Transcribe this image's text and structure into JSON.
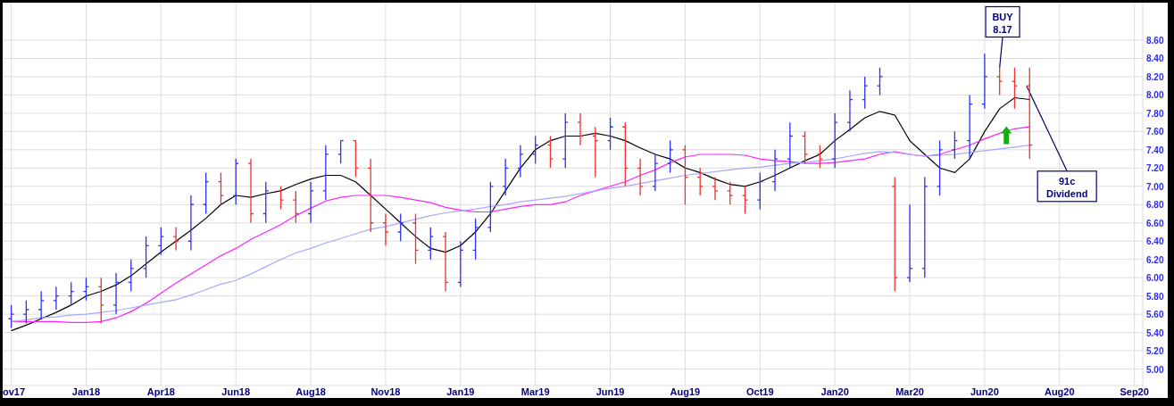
{
  "chart": {
    "chart_data": {
      "type": "line",
      "ylim": [
        4.82,
        9.01
      ],
      "grid": true,
      "categories": [
        "ov17",
        null,
        null,
        null,
        null,
        "Jan18",
        null,
        null,
        null,
        null,
        "Apr18",
        null,
        null,
        null,
        null,
        "Jun18",
        null,
        null,
        null,
        null,
        "Aug18",
        null,
        null,
        null,
        null,
        "Nov18",
        null,
        null,
        null,
        null,
        "Jan19",
        null,
        null,
        null,
        null,
        "Mar19",
        null,
        null,
        null,
        null,
        "Jun19",
        null,
        null,
        null,
        null,
        "Aug19",
        null,
        null,
        null,
        null,
        "Oct19",
        null,
        null,
        null,
        null,
        "Jan20",
        null,
        null,
        null,
        null,
        "Mar20",
        null,
        null,
        null,
        null,
        "Jun20",
        null,
        null,
        null,
        null,
        "Aug20",
        null,
        null,
        null,
        null,
        "Sep20"
      ],
      "yticks": [
        {
          "value": 5.0,
          "label": "5.00"
        },
        {
          "value": 5.2,
          "label": "5.20"
        },
        {
          "value": 5.4,
          "label": "5.40"
        },
        {
          "value": 5.6,
          "label": "5.60"
        },
        {
          "value": 5.8,
          "label": "5.80"
        },
        {
          "value": 6.0,
          "label": "6.00"
        },
        {
          "value": 6.2,
          "label": "6.20"
        },
        {
          "value": 6.4,
          "label": "6.40"
        },
        {
          "value": 6.6,
          "label": "6.60"
        },
        {
          "value": 6.8,
          "label": "6.80"
        },
        {
          "value": 7.0,
          "label": "7.00"
        },
        {
          "value": 7.2,
          "label": "7.20"
        },
        {
          "value": 7.4,
          "label": "7.40"
        },
        {
          "value": 7.6,
          "label": "7.60"
        },
        {
          "value": 7.8,
          "label": "7.80"
        },
        {
          "value": 8.0,
          "label": "8.00"
        },
        {
          "value": 8.2,
          "label": "8.20"
        },
        {
          "value": 8.4,
          "label": "8.40"
        },
        {
          "value": 8.6,
          "label": "8.60"
        }
      ],
      "series": [
        {
          "color": "#000000",
          "values": [
            5.42,
            5.48,
            5.55,
            5.62,
            5.7,
            5.8,
            5.85,
            5.92,
            6.02,
            6.15,
            6.28,
            6.4,
            6.52,
            6.65,
            6.8,
            6.9,
            6.88,
            6.92,
            6.95,
            7.02,
            7.08,
            7.12,
            7.12,
            7.05,
            6.9,
            6.75,
            6.6,
            6.45,
            6.32,
            6.28,
            6.35,
            6.5,
            6.7,
            6.95,
            7.2,
            7.4,
            7.5,
            7.55,
            7.55,
            7.58,
            7.55,
            7.5,
            7.42,
            7.35,
            7.3,
            7.2,
            7.15,
            7.08,
            7.02,
            7.0,
            7.05,
            7.12,
            7.2,
            7.28,
            7.35,
            7.5,
            7.62,
            7.75,
            7.82,
            7.78,
            7.5,
            7.35,
            7.2,
            7.15,
            7.3,
            7.6,
            7.85,
            7.97,
            7.95,
            null,
            null,
            null,
            null,
            null,
            null,
            null
          ]
        },
        {
          "color": "#ff22ff",
          "values": [
            5.52,
            5.52,
            5.52,
            5.52,
            5.51,
            5.51,
            5.52,
            5.56,
            5.63,
            5.72,
            5.83,
            5.94,
            6.04,
            6.14,
            6.24,
            6.32,
            6.42,
            6.5,
            6.58,
            6.68,
            6.76,
            6.84,
            6.88,
            6.9,
            6.9,
            6.9,
            6.88,
            6.85,
            6.82,
            6.77,
            6.74,
            6.72,
            6.72,
            6.75,
            6.78,
            6.8,
            6.8,
            6.83,
            6.9,
            6.95,
            7.0,
            7.05,
            7.12,
            7.18,
            7.26,
            7.32,
            7.35,
            7.35,
            7.35,
            7.34,
            7.3,
            7.28,
            7.27,
            7.25,
            7.25,
            7.26,
            7.28,
            7.3,
            7.35,
            7.38,
            7.35,
            7.33,
            7.35,
            7.4,
            7.45,
            7.52,
            7.58,
            7.63,
            7.65,
            null,
            null,
            null,
            null,
            null,
            null,
            null
          ]
        },
        {
          "color": "#a8a8ff",
          "values": [
            5.52,
            5.54,
            5.56,
            5.57,
            5.59,
            5.6,
            5.62,
            5.64,
            5.67,
            5.7,
            5.73,
            5.76,
            5.81,
            5.87,
            5.93,
            5.97,
            6.04,
            6.12,
            6.2,
            6.27,
            6.32,
            6.38,
            6.43,
            6.48,
            6.53,
            6.56,
            6.6,
            6.64,
            6.68,
            6.71,
            6.73,
            6.75,
            6.78,
            6.8,
            6.83,
            6.85,
            6.87,
            6.89,
            6.92,
            6.95,
            6.98,
            7.0,
            7.03,
            7.06,
            7.09,
            7.12,
            7.14,
            7.16,
            7.18,
            7.2,
            7.21,
            7.23,
            7.25,
            7.26,
            7.28,
            7.3,
            7.33,
            7.36,
            7.38,
            7.37,
            7.35,
            7.33,
            7.34,
            7.35,
            7.37,
            7.39,
            7.41,
            7.43,
            7.45,
            null,
            null,
            null,
            null,
            null,
            null,
            null
          ]
        }
      ],
      "annotations": [
        "BUY\n8.17",
        "91c\nDividend"
      ]
    }
  }
}
